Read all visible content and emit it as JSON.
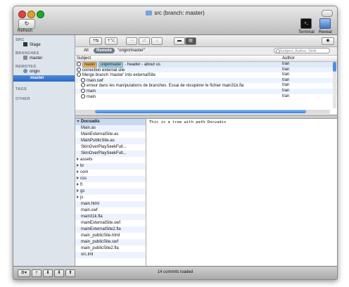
{
  "window": {
    "title": "src (branch: master)"
  },
  "toolbar": {
    "refresh_label": "Refresh",
    "terminal_label": "Terminal",
    "reveal_label": "Reveal"
  },
  "sidebar": {
    "src_head": "SRC",
    "stage": "Stage",
    "branches_head": "BRANCHES",
    "branch_master": "master",
    "remotes_head": "REMOTES",
    "remote_origin": "origin",
    "remote_master": "master",
    "tags_head": "TAGS",
    "other_head": "OTHER"
  },
  "filters": {
    "all": "All",
    "remote": "Remote",
    "ref": "\"origin/master\"",
    "search_placeholder": "Subject, Author, SHA"
  },
  "commits": {
    "subject_header": "Subject",
    "author_header": "Author",
    "tags": [
      "master",
      "origin/master"
    ],
    "rows": [
      {
        "subject": "- header - about us",
        "author": "tran"
      },
      {
        "subject": "correction external site",
        "author": "tran"
      },
      {
        "subject": "Merge branch 'master' into externalSite",
        "author": "tran"
      },
      {
        "subject": "main.swf",
        "author": "tran"
      },
      {
        "subject": "erreur dans les manipulations de branches. Essai de récupérer le fichier main31k.fla",
        "author": "tran"
      },
      {
        "subject": "main",
        "author": "tran"
      },
      {
        "subject": "main",
        "author": "tran"
      }
    ]
  },
  "files": {
    "root": "Docvadis",
    "items": [
      "Main.as",
      "MainExternalSite.as",
      "MainPublicSite.as",
      "SkinOverPlaySeekFull...",
      "SkinOverPlaySeekFull...",
      "assets",
      "br",
      "com",
      "css",
      "fl",
      "gs",
      "js",
      "main.html",
      "main.swf",
      "main31k.fla",
      "mainExternalSite.swf",
      "mainExternalSite2.fla",
      "main_publicSite.html",
      "main_publicSite.swf",
      "main_publicSite2.fla",
      "src.iml"
    ]
  },
  "content": {
    "text": "This is a tree with path Docvadis"
  },
  "status": {
    "text": "14 commits loaded"
  }
}
